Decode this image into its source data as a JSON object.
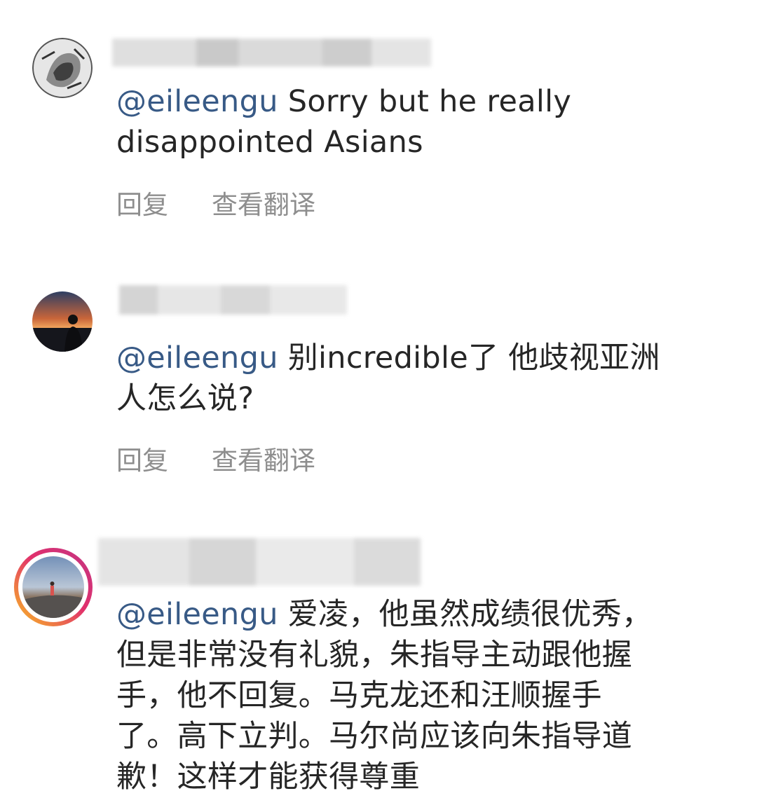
{
  "comments": [
    {
      "mention": "@eileengu",
      "text": " Sorry but he really\ndisappointed Asians",
      "reply_label": "回复",
      "translate_label": "查看翻译",
      "avatar": "sketch-portrait-avatar"
    },
    {
      "mention": "@eileengu",
      "text": " 别incredible了 他歧视亚洲\n人怎么说?",
      "reply_label": "回复",
      "translate_label": "查看翻译",
      "avatar": "sunset-silhouette-avatar"
    },
    {
      "mention": "@eileengu",
      "text": " 爱凌，他虽然成绩很优秀，\n但是非常没有礼貌，朱指导主动跟他握\n手，他不回复。马克龙还和汪顺握手\n了。高下立判。马尔尚应该向朱指导道\n歉！这样才能获得尊重",
      "avatar": "story-ring-landscape-avatar",
      "avatar_ring_colors": [
        "#f9c021",
        "#e1306c",
        "#c13584"
      ]
    }
  ]
}
